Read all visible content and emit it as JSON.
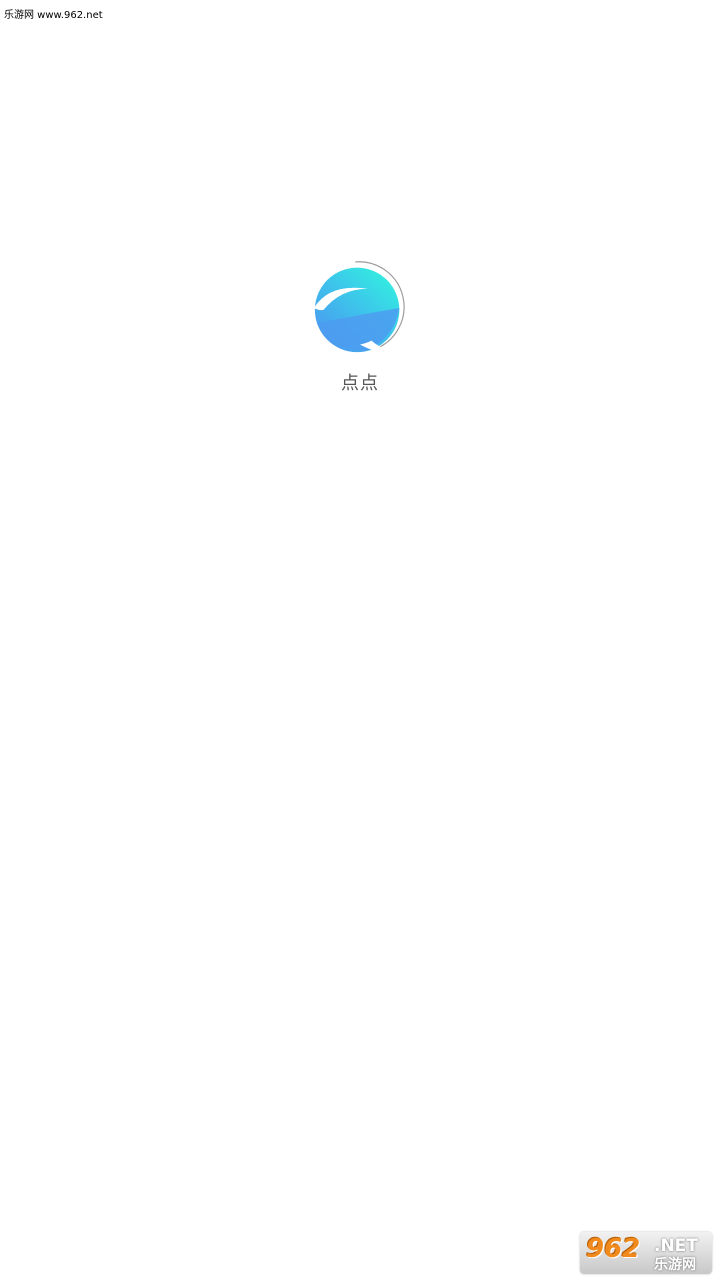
{
  "watermark_top": "乐游网 www.962.net",
  "splash": {
    "logo_icon": "earth-swirl-logo-icon",
    "app_name": "点点"
  },
  "watermark_bottom": {
    "number": "962",
    "suffix": ".NET",
    "site_name": "乐游网"
  },
  "colors": {
    "background": "#ffffff",
    "logo_top": "#33e6e0",
    "logo_bottom": "#4a9cf0",
    "app_name_text": "#555555",
    "watermark_orange": "#f08a1c"
  }
}
